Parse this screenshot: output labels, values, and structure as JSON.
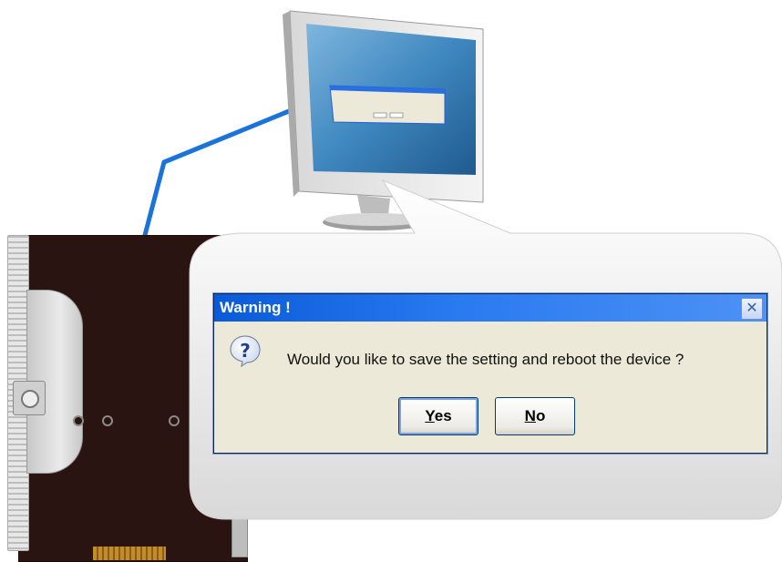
{
  "dialog": {
    "title": "Warning !",
    "close_label": "✕",
    "message": "Would you like to save the setting and reboot the device ?",
    "buttons": {
      "yes": {
        "mnemonic": "Y",
        "rest": "es"
      },
      "no": {
        "mnemonic": "N",
        "rest": "o"
      }
    }
  },
  "colors": {
    "titlebar": "#2a7af0",
    "dialog_bg": "#ece9d8",
    "device_body": "#2a1411",
    "cable": "#1a73d9"
  },
  "icons": {
    "question": "question-icon",
    "close": "close-icon"
  }
}
